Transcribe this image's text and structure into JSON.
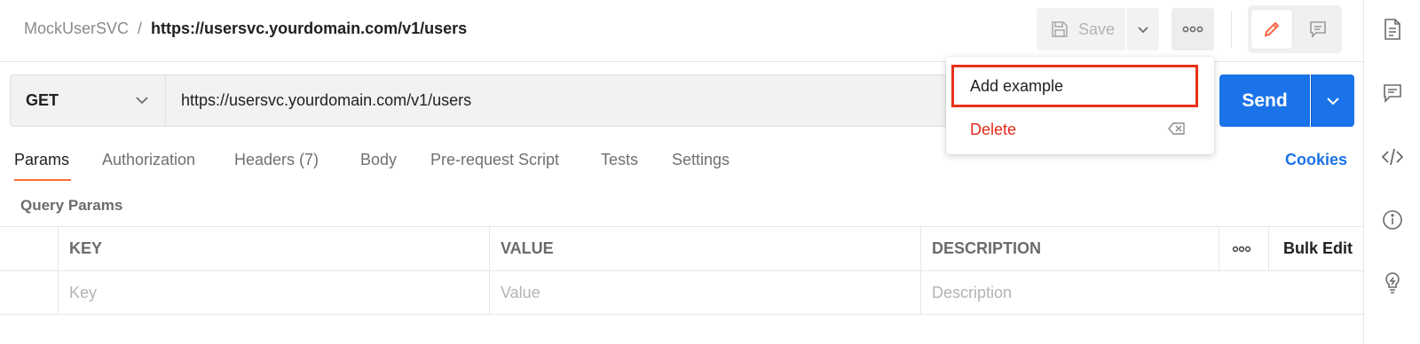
{
  "breadcrumb": {
    "parent": "MockUserSVC",
    "separator": "/",
    "current": "https://usersvc.yourdomain.com/v1/users"
  },
  "toolbar": {
    "save_label": "Save"
  },
  "request": {
    "method": "GET",
    "url": "https://usersvc.yourdomain.com/v1/users",
    "send_label": "Send"
  },
  "menu": {
    "items": [
      {
        "label": "Add example"
      },
      {
        "label": "Delete"
      }
    ]
  },
  "tabs": [
    {
      "label": "Params"
    },
    {
      "label": "Authorization"
    },
    {
      "label": "Headers (7)"
    },
    {
      "label": "Body"
    },
    {
      "label": "Pre-request Script"
    },
    {
      "label": "Tests"
    },
    {
      "label": "Settings"
    }
  ],
  "cookies_label": "Cookies",
  "query_params": {
    "title": "Query Params",
    "columns": [
      "KEY",
      "VALUE",
      "DESCRIPTION"
    ],
    "bulk_edit_label": "Bulk Edit",
    "placeholders": {
      "key": "Key",
      "value": "Value",
      "description": "Description"
    }
  },
  "colors": {
    "accent": "#ff6c37",
    "send": "#1a73e8",
    "delete": "#e02b1a",
    "highlight": "#e8311a"
  },
  "icons": [
    "save-icon",
    "chevron-down-icon",
    "more-icon",
    "pencil-icon",
    "comment-icon",
    "document-icon",
    "comments-icon",
    "code-icon",
    "info-icon",
    "lightbulb-icon",
    "backspace-icon"
  ]
}
